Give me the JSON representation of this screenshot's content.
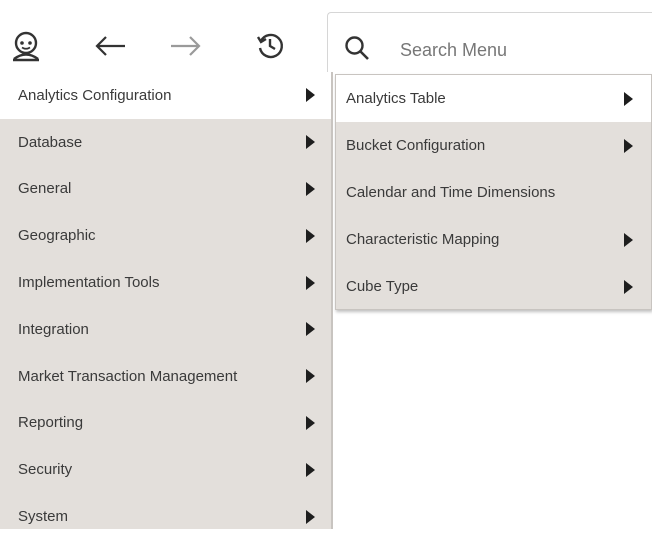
{
  "toolbar": {
    "icons": [
      "user-logo-icon",
      "back-arrow-icon",
      "forward-arrow-icon",
      "history-icon"
    ]
  },
  "search": {
    "placeholder": "Search Menu",
    "icon": "search-icon"
  },
  "left_menu": {
    "items": [
      {
        "label": "Analytics Configuration",
        "has_submenu": true,
        "active": true
      },
      {
        "label": "Database",
        "has_submenu": true
      },
      {
        "label": "General",
        "has_submenu": true
      },
      {
        "label": "Geographic",
        "has_submenu": true
      },
      {
        "label": "Implementation Tools",
        "has_submenu": true
      },
      {
        "label": "Integration",
        "has_submenu": true
      },
      {
        "label": "Market Transaction Management",
        "has_submenu": true
      },
      {
        "label": "Reporting",
        "has_submenu": true
      },
      {
        "label": "Security",
        "has_submenu": true
      },
      {
        "label": "System",
        "has_submenu": true
      }
    ]
  },
  "right_menu": {
    "items": [
      {
        "label": "Analytics Table",
        "has_submenu": true,
        "active": true
      },
      {
        "label": "Bucket Configuration",
        "has_submenu": true
      },
      {
        "label": "Calendar and Time Dimensions",
        "has_submenu": false
      },
      {
        "label": "Characteristic Mapping",
        "has_submenu": true
      },
      {
        "label": "Cube Type",
        "has_submenu": true
      }
    ]
  },
  "colors": {
    "menu_bg": "#e3dfdb",
    "active_bg": "#ffffff",
    "text": "#3a3a3a",
    "arrow": "#1e1e1e"
  }
}
